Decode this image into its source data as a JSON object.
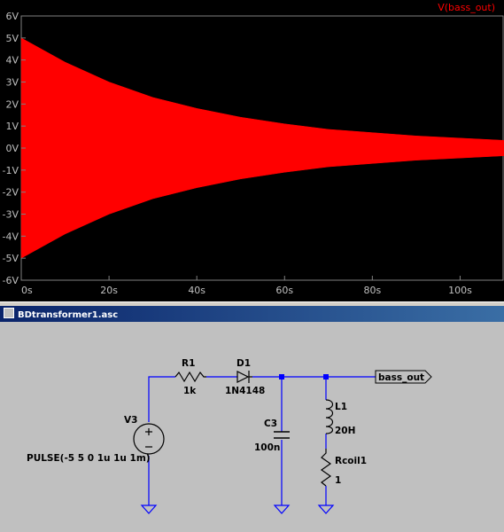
{
  "window": {
    "title": "BDtransformer1.asc"
  },
  "colors": {
    "trace": "#ff0000",
    "plot_background": "#000000",
    "axis_text": "#c0c0c0",
    "wire": "#0000ff",
    "schematic_background": "#c0c0c0",
    "grid": "#808080"
  },
  "chart_data": {
    "type": "area",
    "series": [
      {
        "name": "V(bass_out)",
        "color": "#ff0000",
        "envelope": "decaying oscillation, amplitude 5V at t=0 to about 0.35V at t=110s",
        "x": [
          0,
          10,
          20,
          30,
          40,
          50,
          60,
          70,
          80,
          90,
          100,
          110
        ],
        "upper": [
          5.0,
          3.9,
          3.0,
          2.3,
          1.8,
          1.4,
          1.1,
          0.85,
          0.7,
          0.55,
          0.45,
          0.35
        ],
        "lower": [
          -5.0,
          -3.9,
          -3.0,
          -2.3,
          -1.8,
          -1.4,
          -1.1,
          -0.85,
          -0.7,
          -0.55,
          -0.45,
          -0.35
        ]
      }
    ],
    "xlim": [
      0,
      110
    ],
    "ylim": [
      -6,
      6
    ],
    "x_ticks": [
      "0s",
      "20s",
      "40s",
      "60s",
      "80s",
      "100s"
    ],
    "x_tick_values": [
      0,
      20,
      40,
      60,
      80,
      100
    ],
    "y_ticks": [
      "6V",
      "5V",
      "4V",
      "3V",
      "2V",
      "1V",
      "0V",
      "-1V",
      "-2V",
      "-3V",
      "-4V",
      "-5V",
      "-6V"
    ],
    "y_tick_values": [
      6,
      5,
      4,
      3,
      2,
      1,
      0,
      -1,
      -2,
      -3,
      -4,
      -5,
      -6
    ],
    "grid": false,
    "legend": "top-right"
  },
  "schematic": {
    "r1": {
      "name": "R1",
      "value": "1k"
    },
    "d1": {
      "name": "D1",
      "value": "1N4148"
    },
    "c3": {
      "name": "C3",
      "value": "100n"
    },
    "l1": {
      "name": "L1",
      "value": "20H"
    },
    "rcoil": {
      "name": "Rcoil1",
      "value": "1"
    },
    "v3": {
      "name": "V3",
      "value": "PULSE(-5 5 0 1u 1u 1m)"
    },
    "net_label": "bass_out"
  }
}
